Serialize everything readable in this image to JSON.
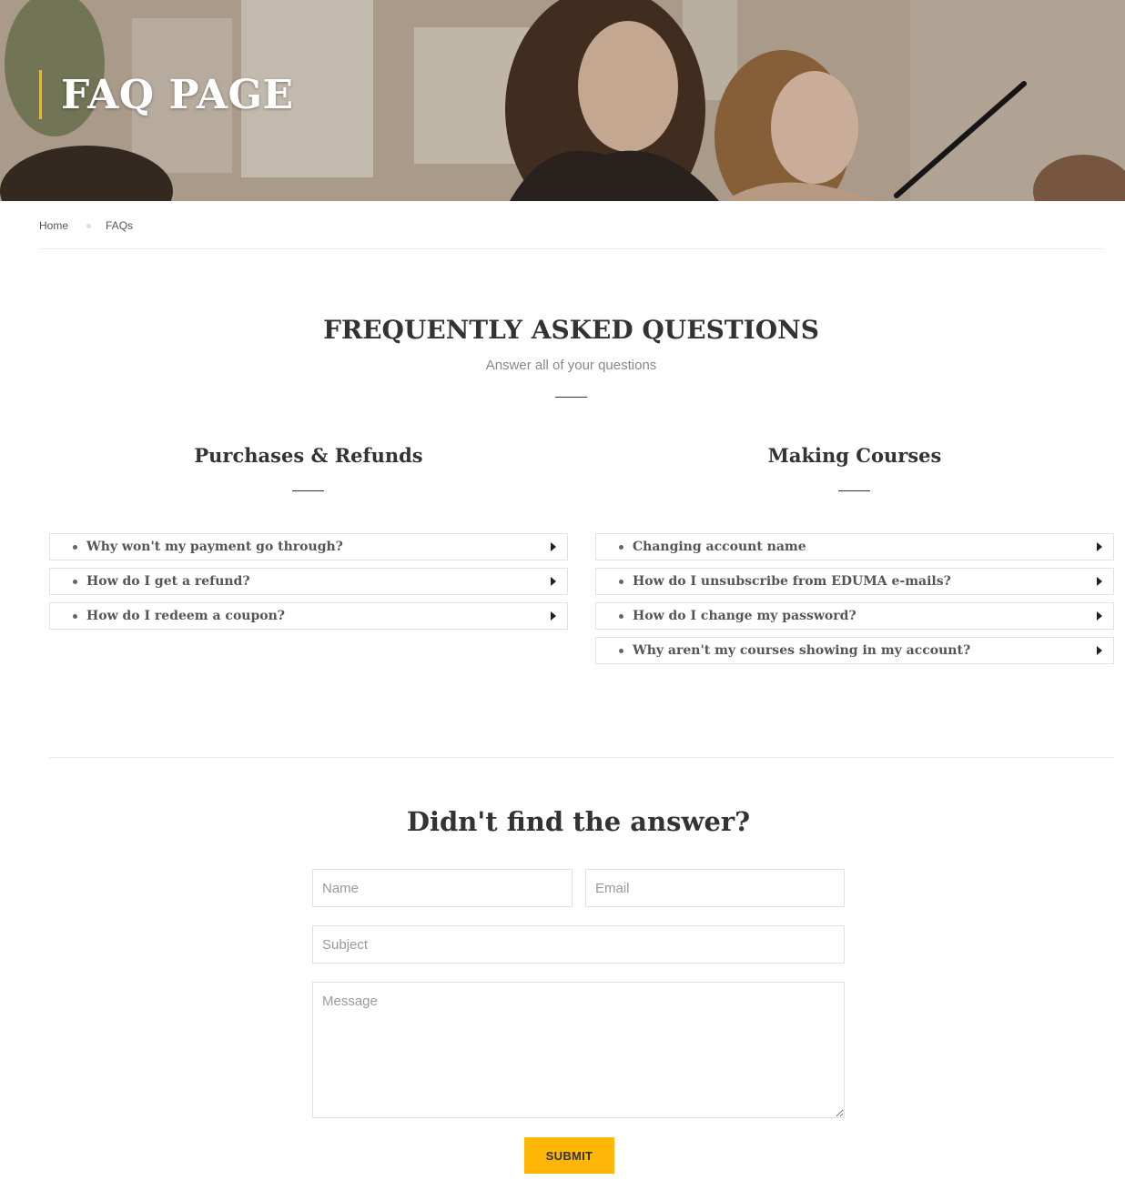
{
  "hero": {
    "title": "FAQ PAGE"
  },
  "breadcrumb": {
    "items": [
      "Home",
      "FAQs"
    ]
  },
  "faq_section": {
    "title": "FREQUENTLY ASKED QUESTIONS",
    "subtitle": "Answer all of your questions",
    "columns": [
      {
        "heading": "Purchases & Refunds",
        "questions": [
          "Why won't my payment go through?",
          "How do I get a refund?",
          "How do I redeem a coupon?"
        ]
      },
      {
        "heading": "Making Courses",
        "questions": [
          "Changing account name",
          "How do I unsubscribe from EDUMA e-mails?",
          "How do I change my password?",
          "Why aren't my courses showing in my account?"
        ]
      }
    ]
  },
  "contact_form": {
    "title": "Didn't find the answer?",
    "name_placeholder": "Name",
    "email_placeholder": "Email",
    "subject_placeholder": "Subject",
    "message_placeholder": "Message",
    "submit_label": "SUBMIT"
  },
  "colors": {
    "accent": "#ffb606",
    "heading": "#333333",
    "muted": "#888888"
  },
  "icons": {
    "faq_bullet": "bullet-icon",
    "faq_toggle": "caret-right-icon"
  }
}
